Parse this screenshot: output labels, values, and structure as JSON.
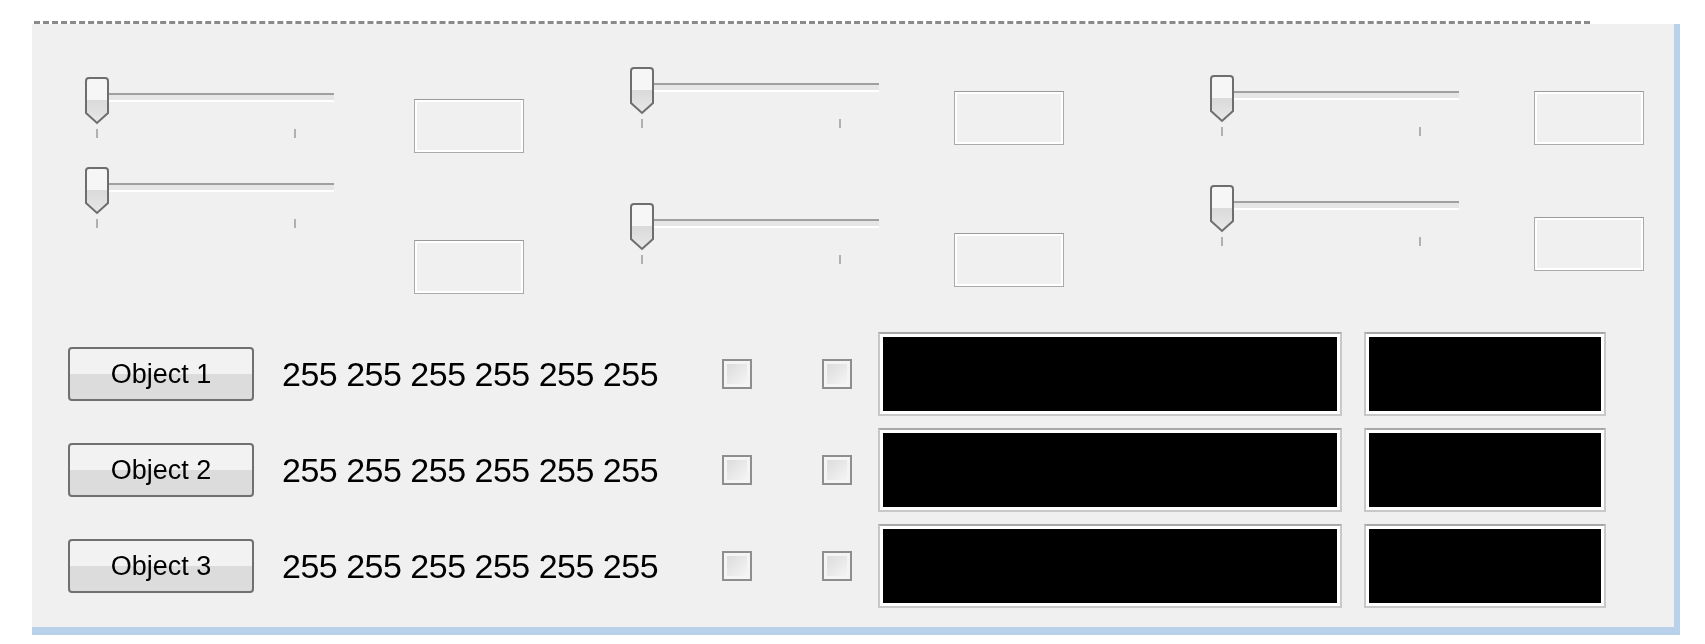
{
  "slider_columns": [
    {
      "sliders": [
        {
          "level": 0
        },
        {
          "level": 0
        }
      ]
    },
    {
      "sliders": [
        {
          "level": 0
        },
        {
          "level": 0
        }
      ]
    },
    {
      "sliders": [
        {
          "level": 0
        },
        {
          "level": 0
        }
      ]
    }
  ],
  "objects": [
    {
      "button": "Object 1",
      "values": "255 255 255 255 255 255",
      "check_1": {
        "checked": false
      },
      "check_2": {
        "checked": false
      }
    },
    {
      "button": "Object 2",
      "values": "255 255 255 255 255 255",
      "check_1": {
        "checked": false
      },
      "check_2": {
        "checked": false
      }
    },
    {
      "button": "Object 3",
      "values": "255 255 255 255 255 255",
      "check_1": {
        "checked": false
      },
      "check_2": {
        "checked": false
      }
    }
  ]
}
